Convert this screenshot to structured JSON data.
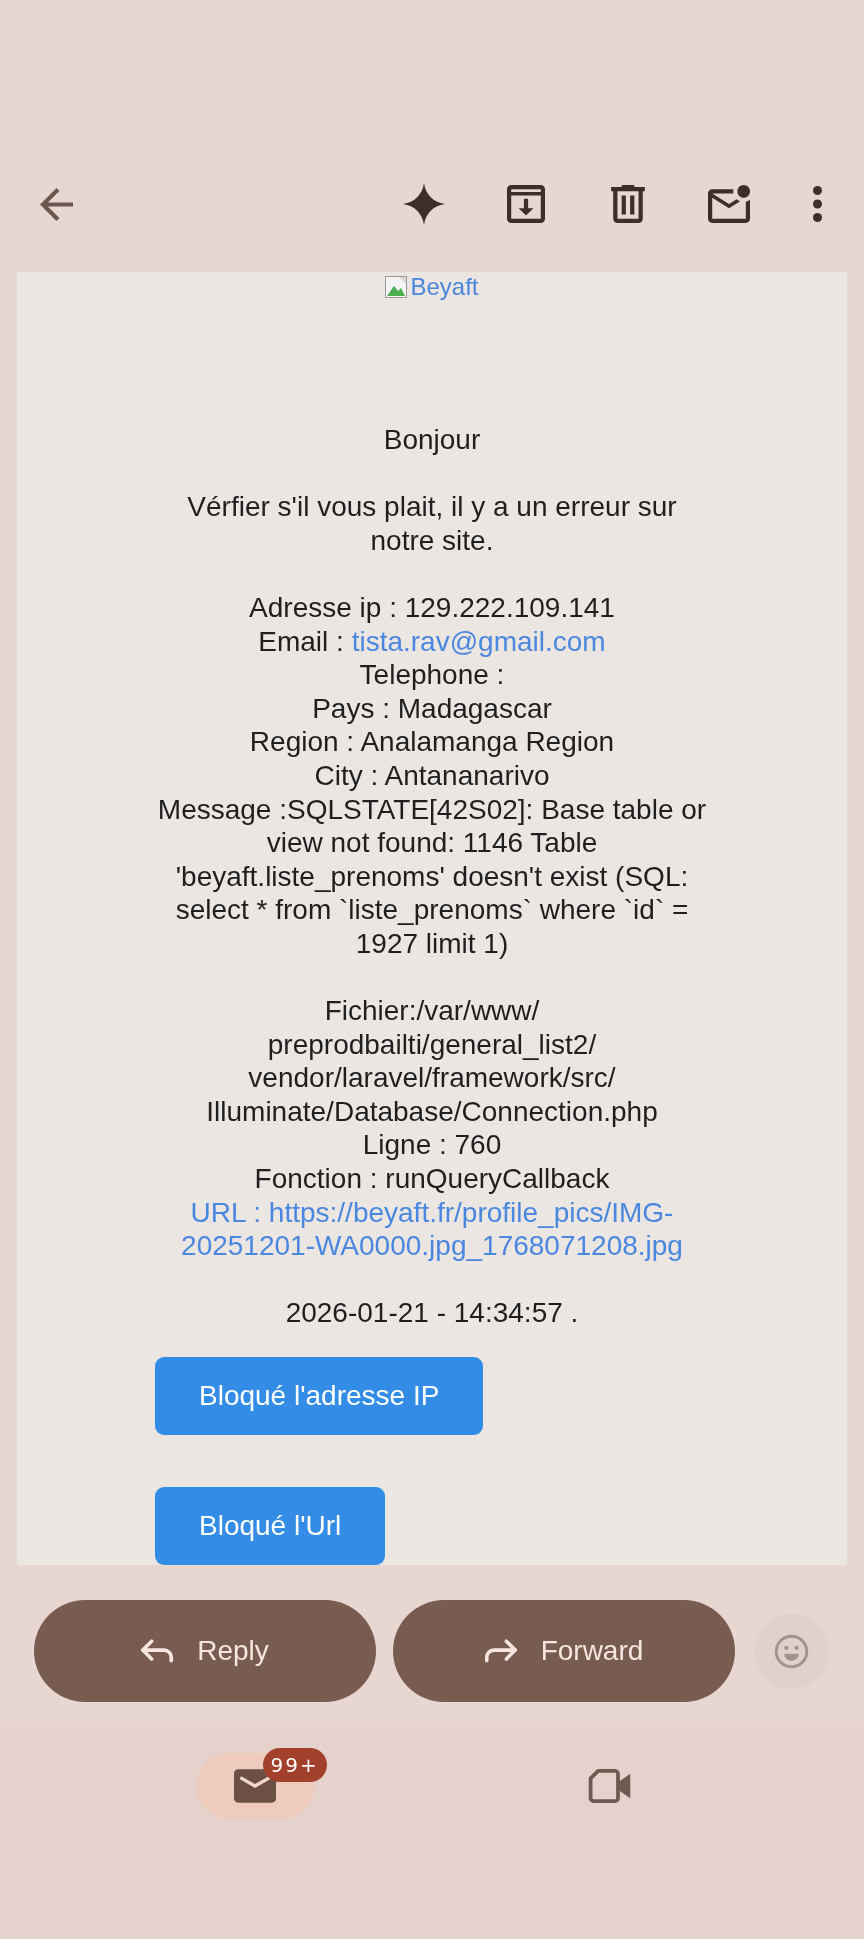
{
  "email": {
    "image_alt": "Beyaft",
    "paragraphs": [
      {
        "lines": [
          {
            "kind": "text",
            "text": "Bonjour"
          }
        ]
      },
      {
        "lines": [
          {
            "kind": "text",
            "text": "Vérfier s'il vous plait, il y a un erreur sur notre site."
          }
        ]
      },
      {
        "lines": [
          {
            "kind": "text",
            "text": "Adresse ip : 129.222.109.141"
          },
          {
            "kind": "labeled-link",
            "text": "Email :",
            "link": "tista.rav@gmail.com"
          },
          {
            "kind": "text",
            "text": "Telephone :"
          },
          {
            "kind": "text",
            "text": "Pays : Madagascar"
          },
          {
            "kind": "text",
            "text": "Region : Analamanga Region"
          },
          {
            "kind": "text",
            "text": "City : Antananarivo"
          },
          {
            "kind": "text",
            "text": "Message :SQLSTATE[42S02]: Base table or view not found: 1146 Table 'beyaft.liste_prenoms' doesn't exist (SQL: select * from `liste_prenoms` where `id` = 1927 limit 1)"
          }
        ]
      },
      {
        "lines": [
          {
            "kind": "text",
            "text": "Fichier:/var/www/\npreprodbailti/general_list2/\nvendor/laravel/framework/src/\nIlluminate/Database/Connection.php"
          },
          {
            "kind": "text",
            "text": "Ligne : 760"
          },
          {
            "kind": "text",
            "text": "Fonction : runQueryCallback"
          },
          {
            "kind": "link",
            "text": "URL : https://beyaft.fr/profile_pics/IMG-20251201-WA0000.jpg_1768071208.jpg"
          }
        ]
      },
      {
        "lines": [
          {
            "kind": "text",
            "text": "2026-01-21 - 14:34:57 ."
          }
        ]
      }
    ],
    "buttons": [
      {
        "label": "Bloqué l'adresse IP"
      },
      {
        "label": "Bloqué l'Url"
      }
    ]
  },
  "actions": [
    {
      "kind": "reply",
      "label": "Reply"
    },
    {
      "kind": "forward",
      "label": "Forward"
    }
  ],
  "bottom_nav": [
    {
      "kind": "mail",
      "selected": true,
      "badge": "99+"
    },
    {
      "kind": "video",
      "selected": false
    }
  ]
}
